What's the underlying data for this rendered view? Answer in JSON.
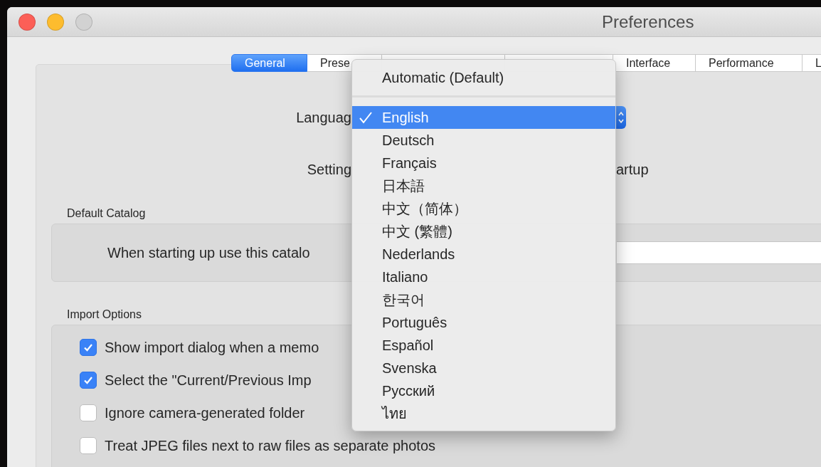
{
  "window": {
    "title": "Preferences"
  },
  "tabs": [
    {
      "label": "General",
      "selected": true
    },
    {
      "label": "Prese",
      "selected": false
    },
    {
      "selected": false
    },
    {
      "selected": false
    },
    {
      "label": "Interface",
      "selected": false
    },
    {
      "label": "Performance",
      "selected": false
    },
    {
      "label": "L",
      "selected": false
    }
  ],
  "general": {
    "language_label": "Languag",
    "settings_label": "Setting",
    "settings_value": "artup",
    "default_catalog": {
      "title": "Default Catalog",
      "label": "When starting up use this catalo"
    },
    "import_options": {
      "title": "Import Options",
      "options": [
        {
          "label": "Show import dialog when a memo",
          "checked": true
        },
        {
          "label": "Select the \"Current/Previous Imp",
          "checked": true
        },
        {
          "label": "Ignore camera-generated folder",
          "checked": false
        },
        {
          "label": "Treat JPEG files next to raw files as separate photos",
          "checked": false
        }
      ]
    }
  },
  "language_menu": {
    "items": [
      {
        "kind": "item",
        "label": "Automatic (Default)",
        "selected": false
      },
      {
        "kind": "separator"
      },
      {
        "kind": "item",
        "label": "English",
        "selected": true
      },
      {
        "kind": "item",
        "label": "Deutsch",
        "selected": false
      },
      {
        "kind": "item",
        "label": "Français",
        "selected": false
      },
      {
        "kind": "item",
        "label": "日本語",
        "selected": false
      },
      {
        "kind": "item",
        "label": "中文（简体）",
        "selected": false
      },
      {
        "kind": "item",
        "label": "中文 (繁體)",
        "selected": false
      },
      {
        "kind": "item",
        "label": "Nederlands",
        "selected": false
      },
      {
        "kind": "item",
        "label": "Italiano",
        "selected": false
      },
      {
        "kind": "item",
        "label": "한국어",
        "selected": false
      },
      {
        "kind": "item",
        "label": "Português",
        "selected": false
      },
      {
        "kind": "item",
        "label": "Español",
        "selected": false
      },
      {
        "kind": "item",
        "label": "Svenska",
        "selected": false
      },
      {
        "kind": "item",
        "label": "Русский",
        "selected": false
      },
      {
        "kind": "item",
        "label": "ไทย",
        "selected": false
      }
    ]
  }
}
